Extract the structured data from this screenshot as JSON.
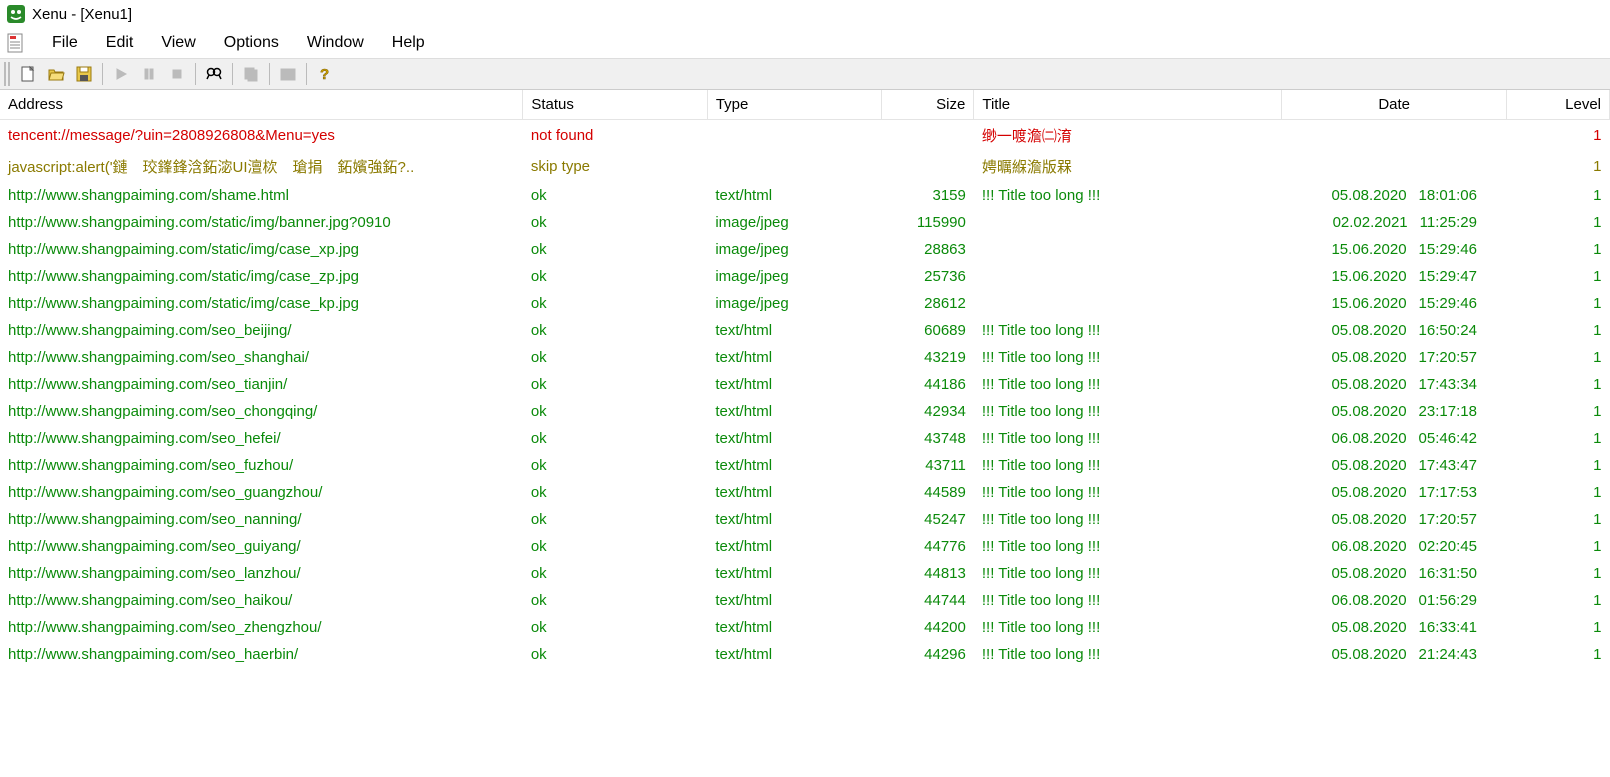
{
  "window": {
    "title": "Xenu - [Xenu1]"
  },
  "menu": {
    "items": [
      "File",
      "Edit",
      "View",
      "Options",
      "Window",
      "Help"
    ]
  },
  "columns": {
    "address": "Address",
    "status": "Status",
    "type": "Type",
    "size": "Size",
    "title": "Title",
    "date": "Date",
    "level": "Level"
  },
  "rows": [
    {
      "color": "red",
      "address": "tencent://message/?uin=2808926808&Menu=yes",
      "status": "not found",
      "type": "",
      "size": "",
      "title": "缈一喥澹㈡淯",
      "date": "",
      "time": "",
      "level": "1"
    },
    {
      "color": "olive",
      "address": "javascript:alert('鏈　珓鎽鋒浛鉐淧UI澶栨　瑲捐　鉐嬪強鉐?..",
      "status": "skip type",
      "type": "",
      "size": "",
      "title": "娉曞緥澹版槑",
      "date": "",
      "time": "",
      "level": "1"
    },
    {
      "color": "green",
      "address": "http://www.shangpaiming.com/shame.html",
      "status": "ok",
      "type": "text/html",
      "size": "3159",
      "title": "!!! Title too long !!!",
      "date": "05.08.2020",
      "time": "18:01:06",
      "level": "1"
    },
    {
      "color": "green",
      "address": "http://www.shangpaiming.com/static/img/banner.jpg?0910",
      "status": "ok",
      "type": "image/jpeg",
      "size": "115990",
      "title": "",
      "date": "02.02.2021",
      "time": "11:25:29",
      "level": "1"
    },
    {
      "color": "green",
      "address": "http://www.shangpaiming.com/static/img/case_xp.jpg",
      "status": "ok",
      "type": "image/jpeg",
      "size": "28863",
      "title": "",
      "date": "15.06.2020",
      "time": "15:29:46",
      "level": "1"
    },
    {
      "color": "green",
      "address": "http://www.shangpaiming.com/static/img/case_zp.jpg",
      "status": "ok",
      "type": "image/jpeg",
      "size": "25736",
      "title": "",
      "date": "15.06.2020",
      "time": "15:29:47",
      "level": "1"
    },
    {
      "color": "green",
      "address": "http://www.shangpaiming.com/static/img/case_kp.jpg",
      "status": "ok",
      "type": "image/jpeg",
      "size": "28612",
      "title": "",
      "date": "15.06.2020",
      "time": "15:29:46",
      "level": "1"
    },
    {
      "color": "green",
      "address": "http://www.shangpaiming.com/seo_beijing/",
      "status": "ok",
      "type": "text/html",
      "size": "60689",
      "title": "!!! Title too long !!!",
      "date": "05.08.2020",
      "time": "16:50:24",
      "level": "1"
    },
    {
      "color": "green",
      "address": "http://www.shangpaiming.com/seo_shanghai/",
      "status": "ok",
      "type": "text/html",
      "size": "43219",
      "title": "!!! Title too long !!!",
      "date": "05.08.2020",
      "time": "17:20:57",
      "level": "1"
    },
    {
      "color": "green",
      "address": "http://www.shangpaiming.com/seo_tianjin/",
      "status": "ok",
      "type": "text/html",
      "size": "44186",
      "title": "!!! Title too long !!!",
      "date": "05.08.2020",
      "time": "17:43:34",
      "level": "1"
    },
    {
      "color": "green",
      "address": "http://www.shangpaiming.com/seo_chongqing/",
      "status": "ok",
      "type": "text/html",
      "size": "42934",
      "title": "!!! Title too long !!!",
      "date": "05.08.2020",
      "time": "23:17:18",
      "level": "1"
    },
    {
      "color": "green",
      "address": "http://www.shangpaiming.com/seo_hefei/",
      "status": "ok",
      "type": "text/html",
      "size": "43748",
      "title": "!!! Title too long !!!",
      "date": "06.08.2020",
      "time": "05:46:42",
      "level": "1"
    },
    {
      "color": "green",
      "address": "http://www.shangpaiming.com/seo_fuzhou/",
      "status": "ok",
      "type": "text/html",
      "size": "43711",
      "title": "!!! Title too long !!!",
      "date": "05.08.2020",
      "time": "17:43:47",
      "level": "1"
    },
    {
      "color": "green",
      "address": "http://www.shangpaiming.com/seo_guangzhou/",
      "status": "ok",
      "type": "text/html",
      "size": "44589",
      "title": "!!! Title too long !!!",
      "date": "05.08.2020",
      "time": "17:17:53",
      "level": "1"
    },
    {
      "color": "green",
      "address": "http://www.shangpaiming.com/seo_nanning/",
      "status": "ok",
      "type": "text/html",
      "size": "45247",
      "title": "!!! Title too long !!!",
      "date": "05.08.2020",
      "time": "17:20:57",
      "level": "1"
    },
    {
      "color": "green",
      "address": "http://www.shangpaiming.com/seo_guiyang/",
      "status": "ok",
      "type": "text/html",
      "size": "44776",
      "title": "!!! Title too long !!!",
      "date": "06.08.2020",
      "time": "02:20:45",
      "level": "1"
    },
    {
      "color": "green",
      "address": "http://www.shangpaiming.com/seo_lanzhou/",
      "status": "ok",
      "type": "text/html",
      "size": "44813",
      "title": "!!! Title too long !!!",
      "date": "05.08.2020",
      "time": "16:31:50",
      "level": "1"
    },
    {
      "color": "green",
      "address": "http://www.shangpaiming.com/seo_haikou/",
      "status": "ok",
      "type": "text/html",
      "size": "44744",
      "title": "!!! Title too long !!!",
      "date": "06.08.2020",
      "time": "01:56:29",
      "level": "1"
    },
    {
      "color": "green",
      "address": "http://www.shangpaiming.com/seo_zhengzhou/",
      "status": "ok",
      "type": "text/html",
      "size": "44200",
      "title": "!!! Title too long !!!",
      "date": "05.08.2020",
      "time": "16:33:41",
      "level": "1"
    },
    {
      "color": "green",
      "address": "http://www.shangpaiming.com/seo_haerbin/",
      "status": "ok",
      "type": "text/html",
      "size": "44296",
      "title": "!!! Title too long !!!",
      "date": "05.08.2020",
      "time": "21:24:43",
      "level": "1"
    }
  ]
}
